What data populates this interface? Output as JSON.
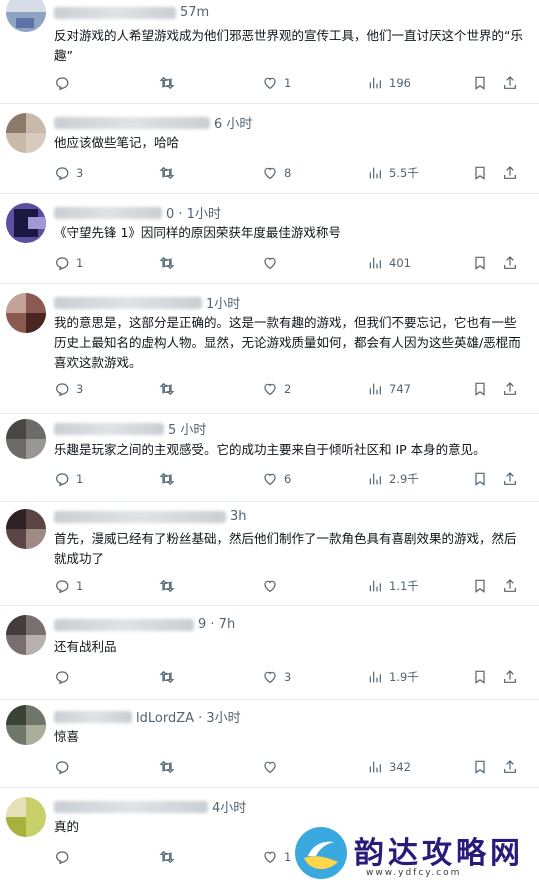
{
  "tweets": [
    {
      "time": "57m",
      "text": "反对游戏的人希望游戏成为他们邪恶世界观的宣传工具，他们一直讨厌这个世界的“乐趣”",
      "stats": {
        "replies": "",
        "retweets": "",
        "likes": "1",
        "views": "196"
      }
    },
    {
      "time": "6 小时",
      "text": "他应该做些笔记，哈哈",
      "stats": {
        "replies": "3",
        "retweets": "",
        "likes": "8",
        "views": "5.5千"
      }
    },
    {
      "time": "0 · 1小时",
      "text": "《守望先锋 1》因同样的原因荣获年度最佳游戏称号",
      "stats": {
        "replies": "1",
        "retweets": "",
        "likes": "",
        "views": "401"
      }
    },
    {
      "time": "1小时",
      "text": "我的意思是，这部分是正确的。这是一款有趣的游戏，但我们不要忘记，它也有一些历史上最知名的虚构人物。显然，无论游戏质量如何，都会有人因为这些英雄/恶棍而喜欢这款游戏。",
      "stats": {
        "replies": "3",
        "retweets": "",
        "likes": "2",
        "views": "747"
      }
    },
    {
      "time": "5 小时",
      "text": "乐趣是玩家之间的主观感受。它的成功主要来自于倾听社区和 IP 本身的意见。",
      "stats": {
        "replies": "1",
        "retweets": "",
        "likes": "6",
        "views": "2.9千"
      }
    },
    {
      "time": "3h",
      "text": "首先，漫威已经有了粉丝基础，然后他们制作了一款角色具有喜剧效果的游戏，然后就成功了",
      "stats": {
        "replies": "1",
        "retweets": "",
        "likes": "",
        "views": "1.1千"
      }
    },
    {
      "time": "9 · 7h",
      "text": "还有战利品",
      "stats": {
        "replies": "",
        "retweets": "",
        "likes": "3",
        "views": "1.9千"
      }
    },
    {
      "time": "ldLordZA · 3小时",
      "text": "惊喜",
      "stats": {
        "replies": "",
        "retweets": "",
        "likes": "",
        "views": "342"
      }
    },
    {
      "time": "4小时",
      "text": "真的",
      "stats": {
        "replies": "",
        "retweets": "",
        "likes": "1",
        "views": ""
      }
    }
  ],
  "watermark": {
    "title": "韵达攻略网",
    "url": "www.ydfcy.com"
  },
  "icons": {
    "reply": "reply-icon",
    "retweet": "retweet-icon",
    "like": "heart-icon",
    "views": "views-icon",
    "bookmark": "bookmark-icon",
    "share": "share-icon"
  }
}
